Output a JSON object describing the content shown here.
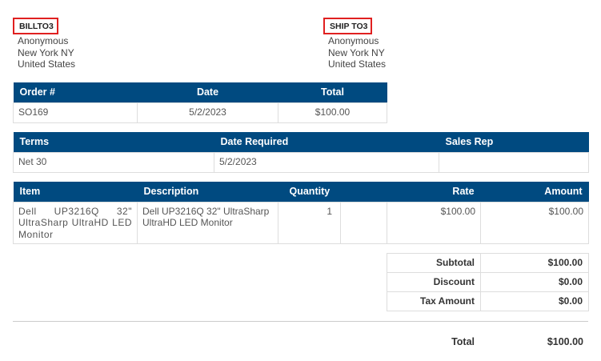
{
  "bill_to": {
    "label": "BILLTO3",
    "name": "Anonymous",
    "city": "New York NY",
    "country": "United States"
  },
  "ship_to": {
    "label": "SHIP TO3",
    "name": "Anonymous",
    "city": "New York NY",
    "country": "United States"
  },
  "order": {
    "headers": {
      "order": "Order #",
      "date": "Date",
      "total": "Total"
    },
    "order_no": "SO169",
    "date": "5/2/2023",
    "total": "$100.00"
  },
  "terms": {
    "headers": {
      "terms": "Terms",
      "date_required": "Date Required",
      "sales_rep": "Sales Rep"
    },
    "terms": "Net 30",
    "date_required": "5/2/2023",
    "sales_rep": ""
  },
  "items": {
    "headers": {
      "item": "Item",
      "description": "Description",
      "quantity": "Quantity",
      "rate": "Rate",
      "amount": "Amount"
    },
    "rows": [
      {
        "item": "Dell UP3216Q 32\" UltraSharp UltraHD LED Monitor",
        "description": "Dell UP3216Q 32\" UltraSharp UltraHD LED Monitor",
        "quantity": "1",
        "rate": "$100.00",
        "amount": "$100.00"
      }
    ]
  },
  "summary": {
    "subtotal_label": "Subtotal",
    "subtotal": "$100.00",
    "discount_label": "Discount",
    "discount": "$0.00",
    "tax_label": "Tax Amount",
    "tax": "$0.00",
    "total_label": "Total",
    "total": "$100.00"
  },
  "colors": {
    "header_bg": "#004a80",
    "highlight_border": "#e02020"
  }
}
